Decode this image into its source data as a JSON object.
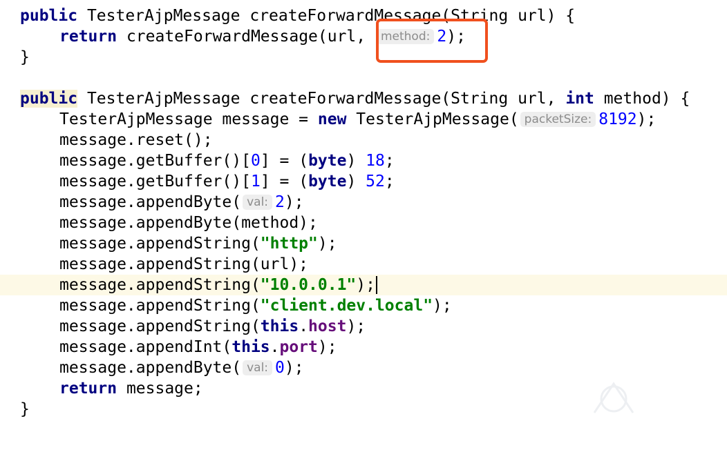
{
  "editor": {
    "line1": {
      "kw": "public",
      "text": " TesterAjpMessage createForwardMessage(String url) {"
    },
    "line2": {
      "kw": "return",
      "text": " createForwardMessage(url, ",
      "hint": "method:",
      "num": "2",
      "end": ");"
    },
    "line3": {
      "text": "}"
    },
    "line5": {
      "kw": "public",
      "text_a": " TesterAjpMessage createForwardMessage(String url, ",
      "kw2": "int",
      "text_b": " method) {"
    },
    "line6": {
      "text_a": "TesterAjpMessage message = ",
      "kw": "new",
      "text_b": " TesterAjpMessage(",
      "hint": "packetSize:",
      "num": "8192",
      "end": ");"
    },
    "line7": {
      "text": "message.reset();"
    },
    "line8": {
      "text_a": "message.getBuffer()[",
      "idx": "0",
      "text_b": "] = (",
      "kw": "byte",
      "text_c": ") ",
      "num": "18",
      "end": ";"
    },
    "line9": {
      "text_a": "message.getBuffer()[",
      "idx": "1",
      "text_b": "] = (",
      "kw": "byte",
      "text_c": ") ",
      "num": "52",
      "end": ";"
    },
    "line10": {
      "text": "message.appendByte(",
      "hint": "val:",
      "num": "2",
      "end": ");"
    },
    "line11": {
      "text": "message.appendByte(method);"
    },
    "line12": {
      "text": "message.appendString(",
      "str": "\"http\"",
      "end": ");"
    },
    "line13": {
      "text": "message.appendString(url);"
    },
    "line14": {
      "text": "message.appendString(",
      "str": "\"10.0.0.1\"",
      "end": ");"
    },
    "line15": {
      "text": "message.appendString(",
      "str": "\"client.dev.local\"",
      "end": ");"
    },
    "line16": {
      "text": "message.appendString(",
      "kw": "this",
      "dot": ".",
      "fld": "host",
      "end": ");"
    },
    "line17": {
      "text": "message.appendInt(",
      "kw": "this",
      "dot": ".",
      "fld": "port",
      "end": ");"
    },
    "line18": {
      "text": "message.appendByte(",
      "hint": "val:",
      "num": "0",
      "end": ");"
    },
    "line19": {
      "kw": "return",
      "text": " message;"
    },
    "line20": {
      "text": "}"
    }
  },
  "colors": {
    "keyword": "#000080",
    "number": "#0000ff",
    "string": "#008000",
    "field": "#660e7a",
    "hint_text": "#8c8c8c",
    "callout_border": "#f0501e",
    "current_line": "#fdf9e6"
  }
}
